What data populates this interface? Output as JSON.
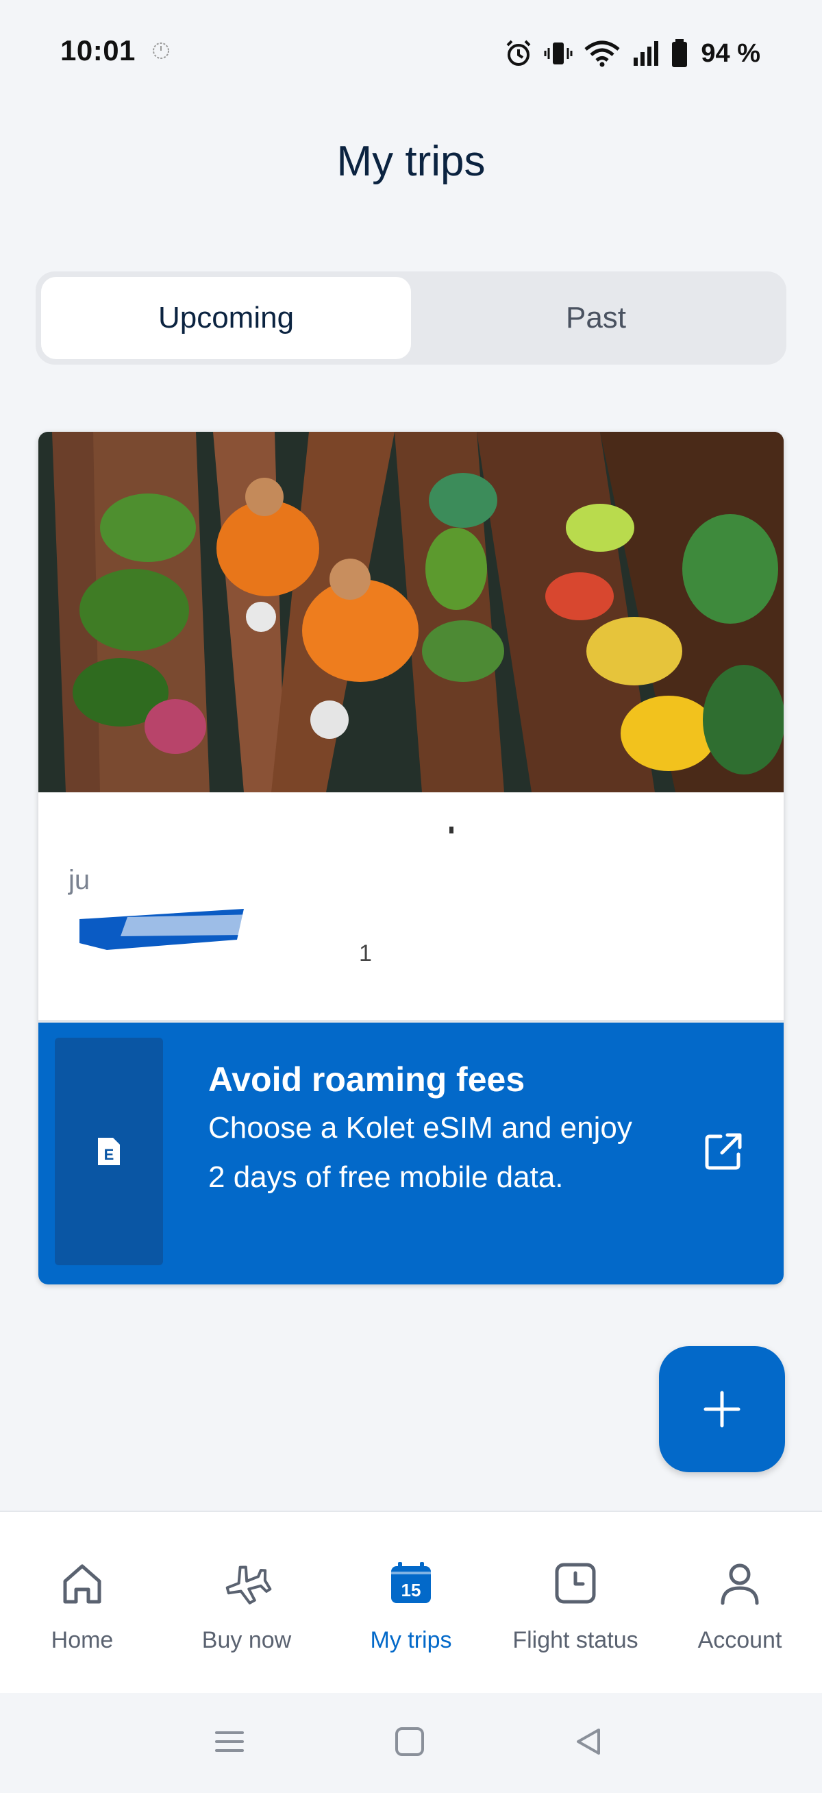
{
  "status_bar": {
    "time": "10:01",
    "battery": "94 %"
  },
  "page": {
    "title": "My trips"
  },
  "tabs": [
    {
      "label": "Upcoming",
      "active": true
    },
    {
      "label": "Past",
      "active": false
    }
  ],
  "trip": {
    "dates": "ju",
    "number": "1"
  },
  "esim_banner": {
    "title": "Avoid roaming fees",
    "text": "Choose a Kolet eSIM and enjoy 2 days of free mobile data.",
    "icon_letter": "E"
  },
  "fab": {
    "icon": "plus-icon"
  },
  "bottom_nav": {
    "items": [
      {
        "label": "Home",
        "icon": "home-icon"
      },
      {
        "label": "Buy now",
        "icon": "plane-icon"
      },
      {
        "label": "My trips",
        "icon": "calendar-icon",
        "badge": "15",
        "active": true
      },
      {
        "label": "Flight status",
        "icon": "clock-icon"
      },
      {
        "label": "Account",
        "icon": "person-icon"
      }
    ]
  },
  "colors": {
    "accent": "#0369C9",
    "banner_dark": "#0A56A4",
    "title": "#0B2340"
  }
}
